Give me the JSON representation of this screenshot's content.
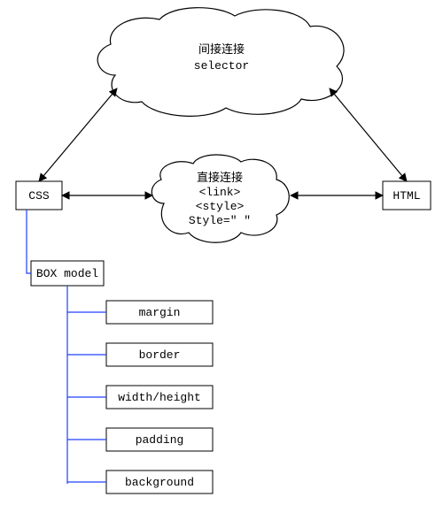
{
  "clouds": {
    "top": {
      "line1": "间接连接",
      "line2": "selector"
    },
    "mid": {
      "line1": "直接连接",
      "line2": "<link>",
      "line3": "<style>",
      "line4": "Style=\" \""
    }
  },
  "nodes": {
    "css": "CSS",
    "html": "HTML",
    "boxmodel": "BOX model",
    "props": {
      "margin": "margin",
      "border": "border",
      "wh": "width/height",
      "padding": "padding",
      "background": "background"
    }
  }
}
